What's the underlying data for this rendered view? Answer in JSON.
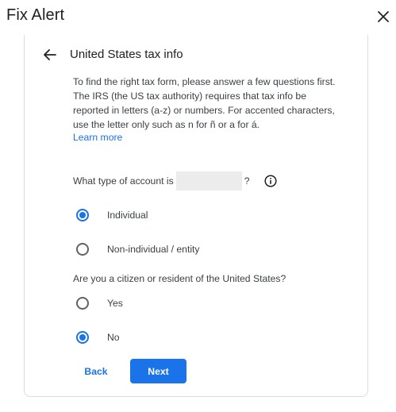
{
  "dialog": {
    "title": "Fix Alert"
  },
  "section": {
    "title": "United States tax info",
    "intro": "To find the right tax form, please answer a few questions first. The IRS (the US tax authority) requires that tax info be reported in letters (a-z) or numbers. For accented characters, use the letter only such as n for ñ or a for á.",
    "learn_more": "Learn more"
  },
  "question1": {
    "prefix": "What type of account is",
    "suffix": "?",
    "options": [
      {
        "label": "Individual",
        "selected": true
      },
      {
        "label": "Non-individual / entity",
        "selected": false
      }
    ]
  },
  "question2": {
    "text": "Are you a citizen or resident of the United States?",
    "options": [
      {
        "label": "Yes",
        "selected": false
      },
      {
        "label": "No",
        "selected": true
      }
    ]
  },
  "buttons": {
    "back": "Back",
    "next": "Next"
  },
  "colors": {
    "accent": "#1a73e8",
    "text": "#3c4043",
    "border": "#dadce0"
  }
}
